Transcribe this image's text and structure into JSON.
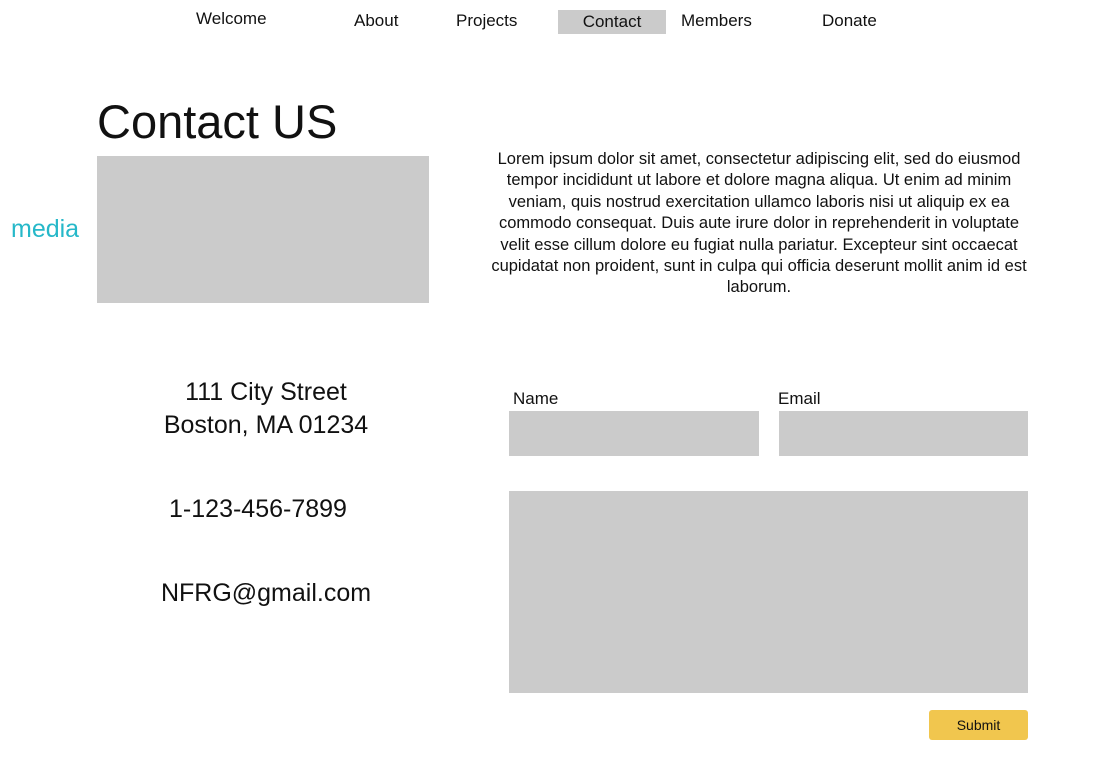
{
  "nav": {
    "items": [
      {
        "label": "Welcome"
      },
      {
        "label": "About"
      },
      {
        "label": "Projects"
      },
      {
        "label": "Contact",
        "active": true
      },
      {
        "label": "Members"
      },
      {
        "label": "Donate"
      }
    ]
  },
  "page": {
    "title": "Contact US",
    "media_label": "media",
    "description": "Lorem ipsum dolor sit amet, consectetur adipiscing elit, sed do eiusmod tempor incididunt ut labore et dolore magna aliqua. Ut enim ad minim veniam, quis nostrud exercitation ullamco laboris nisi ut aliquip ex ea commodo consequat. Duis aute irure dolor in reprehenderit in voluptate velit esse cillum dolore eu fugiat nulla pariatur. Excepteur sint occaecat cupidatat non proident, sunt in culpa qui officia deserunt mollit anim id est laborum."
  },
  "contact_info": {
    "address_line1": "111 City Street",
    "address_line2": "Boston, MA 01234",
    "phone": "1-123-456-7899",
    "email": "NFRG@gmail.com"
  },
  "form": {
    "name_label": "Name",
    "name_value": "",
    "email_label": "Email",
    "email_value": "",
    "message_value": "",
    "submit_label": "Submit"
  },
  "colors": {
    "active_tab_bg": "#cbcbcb",
    "placeholder_gray": "#cbcbcb",
    "media_label": "#26b8c9",
    "submit_button": "#f1c64e"
  }
}
